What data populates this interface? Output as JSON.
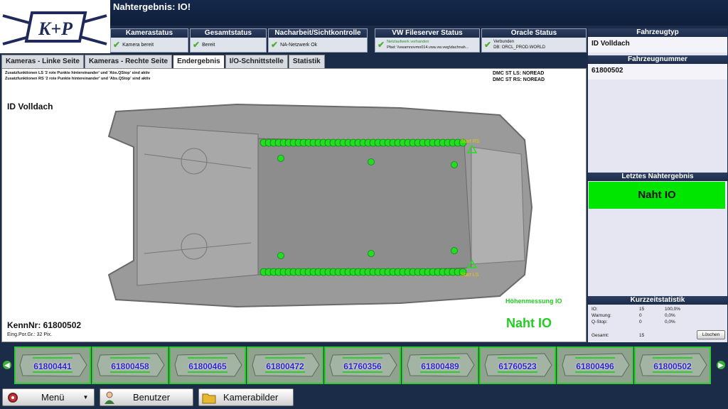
{
  "header": {
    "title": "Nahtergebnis: IO!",
    "logo_text": "K+P"
  },
  "status": [
    {
      "title": "Kamerastatus",
      "lines": [
        "Kamera bereit"
      ]
    },
    {
      "title": "Gesamtstatus",
      "lines": [
        "Bereit"
      ]
    },
    {
      "title": "Nacharbeit/Sichtkontrolle",
      "lines": [
        "NA-Netzwerk Ok"
      ]
    },
    {
      "title": "VW Fileserver Status",
      "lines": [
        "Netzlaufwerk vorhanden",
        "Pfad: \\\\vwamnovmo014.vwa.vw.vwg\\dachnah..."
      ]
    },
    {
      "title": "Oracle Status",
      "lines": [
        "Verbunden",
        "DB:  ORCL_PROD.WORLD"
      ]
    }
  ],
  "tabs": [
    "Kameras - Linke Seite",
    "Kameras - Rechte Seite",
    "Endergebnis",
    "I/O-Schnittstelle",
    "Statistik"
  ],
  "main": {
    "note1": "Zusatzfunktionen LS '2 rote Punkte hintereinander' und 'Abs.QStop' sind aktiv",
    "note2": "Zusatzfunktionen RS '2 rote Punkte hintereinander' und 'Abs.QStop' sind aktiv",
    "dmc_ls": "DMC ST LS:  NOREAD",
    "dmc_rs": "DMC ST RS:  NOREAD",
    "vehicle": "ID Volldach",
    "start_rs": "Start RS",
    "start_ls": "Start LS",
    "height_msg": "Höhenmessung IO",
    "result": "Naht IO",
    "kenn_label": "KennNr:  61800502",
    "pix": "Eing.Por.Gr.: 32 Pix."
  },
  "right": {
    "fahrzeugtyp_title": "Fahrzeugtyp",
    "fahrzeugtyp": "ID Volldach",
    "fahrzeugnummer_title": "Fahrzeugnummer",
    "fahrzeugnummer": "61800502",
    "letztes_title": "Letztes Nahtergebnis",
    "letztes_value": "Naht IO",
    "kurz_title": "Kurzzeitstatistik",
    "stats": [
      {
        "label": "IO:",
        "count": "15",
        "pct": "100,0%"
      },
      {
        "label": "Warnung:",
        "count": "0",
        "pct": "0,0%"
      },
      {
        "label": "Q-Stop:",
        "count": "0",
        "pct": "0,0%"
      }
    ],
    "gesamt_label": "Gesamt:",
    "gesamt_value": "15",
    "loeschen": "Löschen"
  },
  "thumbnails": [
    "61800441",
    "61800458",
    "61800465",
    "61800472",
    "61760356",
    "61800489",
    "61760523",
    "61800496",
    "61800502"
  ],
  "bottom": {
    "menu": "Menü",
    "user": "Benutzer",
    "camera": "Kamerabilder"
  },
  "colors": {
    "navy": "#1a2c48",
    "ok_green": "#00e600",
    "point_green": "#22dd22"
  }
}
